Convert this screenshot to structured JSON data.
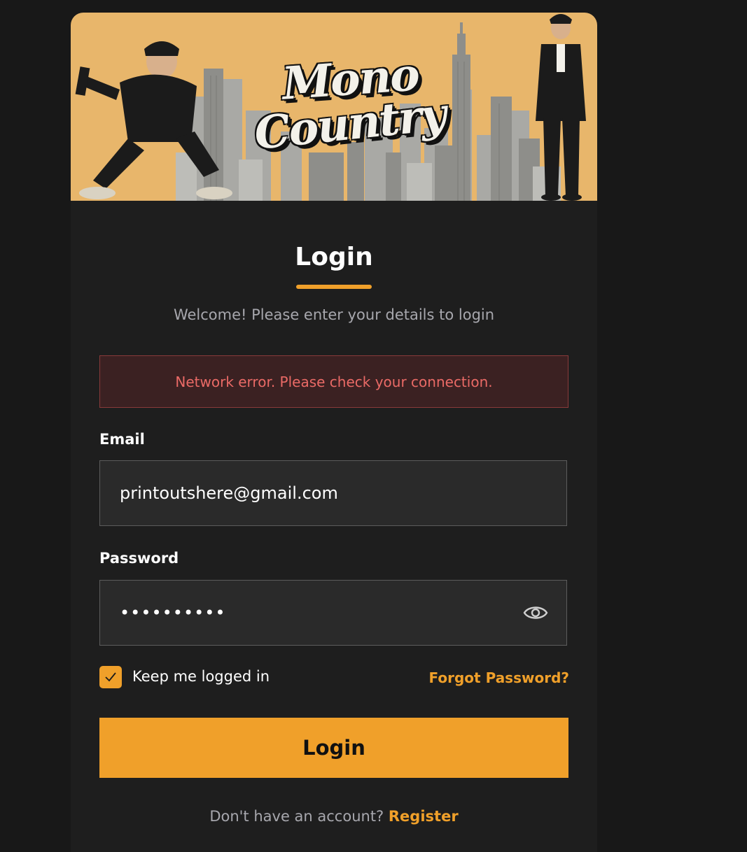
{
  "banner": {
    "logo_line1": "Mono",
    "logo_line2": "Country"
  },
  "login": {
    "title": "Login",
    "subtitle": "Welcome! Please enter your details to login",
    "error_message": "Network error. Please check your connection.",
    "email_label": "Email",
    "email_value": "printoutshere@gmail.com",
    "password_label": "Password",
    "password_value": "••••••••••",
    "remember_checked": true,
    "remember_label": "Keep me logged in",
    "forgot_label": "Forgot Password?",
    "submit_label": "Login",
    "footer_prompt": "Don't have an account?",
    "register_label": "Register"
  },
  "colors": {
    "accent": "#f0a02a",
    "background": "#181818",
    "card": "#1e1e1e",
    "error_text": "#ea6a66",
    "error_bg": "#3b2122",
    "banner_bg": "#e8b66b"
  },
  "icons": {
    "password_toggle": "eye-icon",
    "checkbox_mark": "check-icon"
  }
}
